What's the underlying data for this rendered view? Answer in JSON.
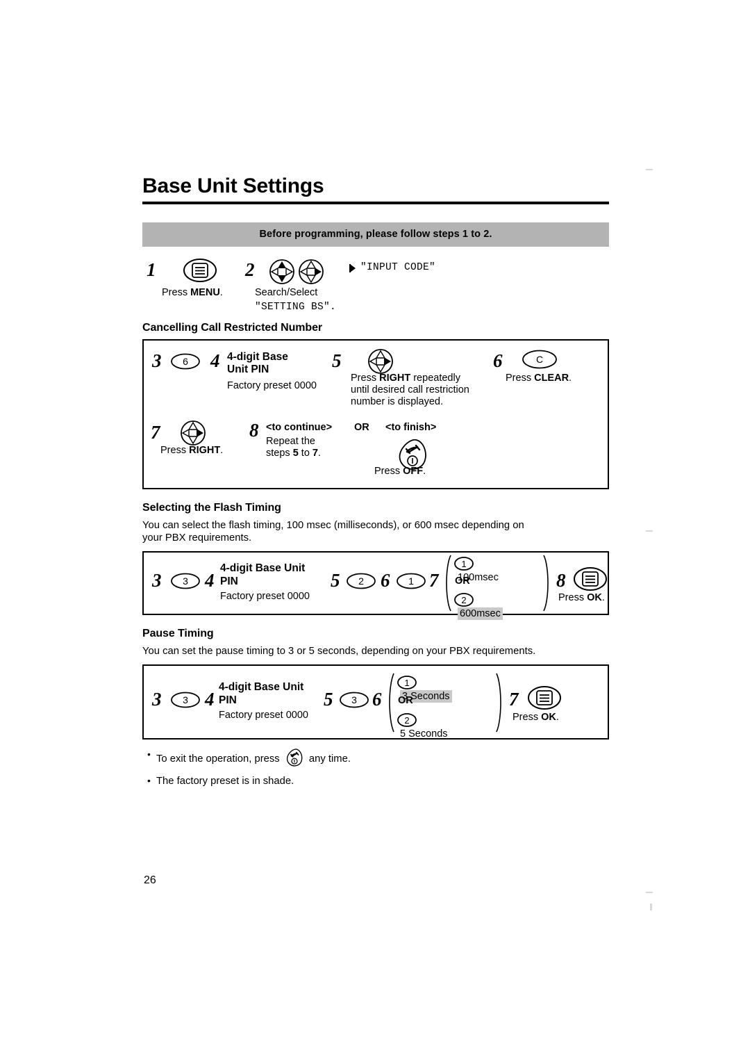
{
  "document": {
    "page_title": "Base Unit Settings",
    "page_number": "26",
    "banner": "Before programming, please follow steps 1 to 2."
  },
  "intro": {
    "step1": {
      "number": "1",
      "icon": "menu-button-icon",
      "caption_prefix": "Press ",
      "caption_key": "MENU",
      "caption_suffix": "."
    },
    "step2": {
      "number": "2",
      "icon_a": "joystick-up-down-icon",
      "icon_b": "joystick-right-icon",
      "caption_line1": "Search/Select",
      "caption_line2": "\"SETTING BS\".",
      "display_marker": "display-arrow-icon",
      "display_text": "\"INPUT CODE\""
    }
  },
  "section_cancel": {
    "heading": "Cancelling Call Restricted Number",
    "step3": {
      "number": "3",
      "key": "6"
    },
    "step4": {
      "number": "4",
      "label_line1": "4-digit Base",
      "label_line2": "Unit PIN",
      "note": "Factory preset 0000"
    },
    "step5": {
      "number": "5",
      "icon": "joystick-right-icon",
      "text_line1_prefix": "Press ",
      "text_line1_key": "RIGHT",
      "text_line1_suffix": " repeatedly",
      "text_line2": "until desired call restriction",
      "text_line3": "number is displayed."
    },
    "step6": {
      "number": "6",
      "key": "C",
      "caption_prefix": "Press ",
      "caption_key": "CLEAR",
      "caption_suffix": "."
    },
    "step7": {
      "number": "7",
      "icon": "joystick-right-icon",
      "caption_prefix": "Press ",
      "caption_key": "RIGHT",
      "caption_suffix": "."
    },
    "step8": {
      "number": "8",
      "continue_label": "<to continue>",
      "continue_line1": "Repeat the",
      "continue_line2_a": "steps ",
      "continue_line2_b": "5",
      "continue_line2_c": " to ",
      "continue_line2_d": "7",
      "continue_line2_e": ".",
      "or_label": "OR",
      "finish_label": "<to finish>",
      "finish_icon": "off-button-icon",
      "finish_caption_prefix": "Press ",
      "finish_caption_key": "OFF",
      "finish_caption_suffix": "."
    }
  },
  "section_flash": {
    "heading": "Selecting the Flash Timing",
    "description_line1": "You can select the flash timing, 100 msec (milliseconds), or 600 msec depending on",
    "description_line2": "your PBX requirements.",
    "step3": {
      "number": "3",
      "key": "3"
    },
    "step4": {
      "number": "4",
      "label_line1": "4-digit Base Unit",
      "label_line2": "PIN",
      "note": "Factory preset 0000"
    },
    "step5": {
      "number": "5",
      "key": "2"
    },
    "step6": {
      "number": "6",
      "key": "1"
    },
    "step7": {
      "number": "7",
      "option1_key": "1",
      "option1_text": "100msec",
      "or_label": "OR",
      "option2_key": "2",
      "option2_text": "600msec",
      "option2_shaded": true
    },
    "step8": {
      "number": "8",
      "icon": "ok-button-icon",
      "caption_prefix": "Press ",
      "caption_key": "OK",
      "caption_suffix": "."
    }
  },
  "section_pause": {
    "heading": "Pause Timing",
    "description": "You can set the pause timing to 3 or 5 seconds, depending on your PBX requirements.",
    "step3": {
      "number": "3",
      "key": "3"
    },
    "step4": {
      "number": "4",
      "label_line1": "4-digit Base Unit",
      "label_line2": "PIN",
      "note": "Factory preset 0000"
    },
    "step5": {
      "number": "5",
      "key": "3"
    },
    "step6": {
      "number": "6",
      "option1_key": "1",
      "option1_text": "3 Seconds",
      "or_label": "OR",
      "option2_key": "2",
      "option2_text": "5 Seconds",
      "option1_shaded": true
    },
    "step7": {
      "number": "7",
      "icon": "ok-button-icon",
      "caption_prefix": "Press ",
      "caption_key": "OK",
      "caption_suffix": "."
    }
  },
  "footnotes": {
    "bullet1_part1": "To exit the operation, press",
    "bullet1_icon": "off-button-icon",
    "bullet1_part2": "any time.",
    "bullet2": "The factory preset is in shade."
  }
}
